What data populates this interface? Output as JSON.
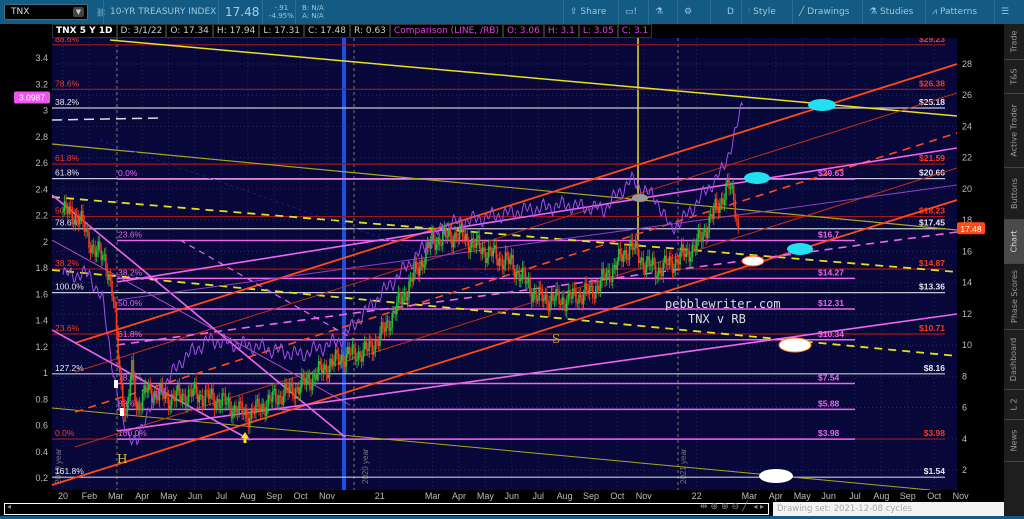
{
  "toolbar": {
    "symbol": "TNX",
    "description": "10-YR TREASURY INDEX",
    "last": "17.48",
    "change": "-.91",
    "change_pct": "-4.95%",
    "bid": "B: N/A",
    "ask": "A: N/A",
    "share": "Share",
    "timeframe": "D",
    "style": "Style",
    "drawings": "Drawings",
    "studies": "Studies",
    "patterns": "Patterns"
  },
  "header": {
    "title": "TNX 5 Y 1D",
    "date": "D: 3/1/22",
    "open": "O: 17.34",
    "high": "H: 17.94",
    "low": "L: 17.31",
    "close": "C: 17.48",
    "range": "R: 0.63",
    "comparison": "Comparison (LINE, /RB)",
    "cmp_open": "O: 3.06",
    "cmp_high": "H: 3.1",
    "cmp_low": "L: 3.05",
    "cmp_close": "C: 3.1"
  },
  "side_tabs": [
    "Trade",
    "T&S",
    "Active Trader",
    "Buttons",
    "Chart",
    "Phase Scores",
    "Dashboard",
    "L 2",
    "News"
  ],
  "footer": {
    "drawing_set": "Drawing set: 2021-12-08 cycles"
  },
  "chart_data": {
    "type": "candlestick",
    "title": "TNX 5 Y 1D vs /RB",
    "colors": {
      "up": "#22c23a",
      "down": "#ff3a1a",
      "comparison": "#a050e8",
      "white_fib": "#c8c8d8",
      "red_fib": "#ff3a1a",
      "pink_fib": "#ee66ee"
    },
    "x_ticks": [
      {
        "label": "20",
        "m": 0
      },
      {
        "label": "Feb",
        "m": 1
      },
      {
        "label": "Mar",
        "m": 2
      },
      {
        "label": "Apr",
        "m": 3
      },
      {
        "label": "May",
        "m": 4
      },
      {
        "label": "Jun",
        "m": 5
      },
      {
        "label": "Jul",
        "m": 6
      },
      {
        "label": "Aug",
        "m": 7
      },
      {
        "label": "Sep",
        "m": 8
      },
      {
        "label": "Oct",
        "m": 9
      },
      {
        "label": "Nov",
        "m": 10
      },
      {
        "label": "21",
        "m": 12
      },
      {
        "label": "Mar",
        "m": 14
      },
      {
        "label": "Apr",
        "m": 15
      },
      {
        "label": "May",
        "m": 16
      },
      {
        "label": "Jun",
        "m": 17
      },
      {
        "label": "Jul",
        "m": 18
      },
      {
        "label": "Aug",
        "m": 19
      },
      {
        "label": "Sep",
        "m": 20
      },
      {
        "label": "Oct",
        "m": 21
      },
      {
        "label": "Nov",
        "m": 22
      },
      {
        "label": "22",
        "m": 24
      },
      {
        "label": "Mar",
        "m": 26
      },
      {
        "label": "Apr",
        "m": 27
      },
      {
        "label": "May",
        "m": 28
      },
      {
        "label": "Jun",
        "m": 29
      },
      {
        "label": "Jul",
        "m": 30
      },
      {
        "label": "Aug",
        "m": 31
      },
      {
        "label": "Sep",
        "m": 32
      },
      {
        "label": "Oct",
        "m": 33
      },
      {
        "label": "Nov",
        "m": 34
      }
    ],
    "y_left_ticks": [
      "3.4",
      "3.2",
      "3",
      "2.8",
      "2.6",
      "2.4",
      "2.2",
      "2",
      "1.8",
      "1.6",
      "1.4",
      "1.2",
      "1",
      "0.8",
      "0.6",
      "0.4",
      "0.2"
    ],
    "y_right_ticks": [
      "28",
      "26",
      "24",
      "22",
      "20",
      "18",
      "16",
      "14",
      "12",
      "10",
      "8",
      "6",
      "4",
      "2"
    ],
    "left_badge": "3.0987",
    "right_badge": "17.48",
    "tnx_series": [
      [
        0,
        18.6
      ],
      [
        0.6,
        18.2
      ],
      [
        1.2,
        16.0
      ],
      [
        1.6,
        15.6
      ],
      [
        1.9,
        12.9
      ],
      [
        2.2,
        7.5
      ],
      [
        2.4,
        5.2
      ],
      [
        2.6,
        8.5
      ],
      [
        2.8,
        6.0
      ],
      [
        3.2,
        7.1
      ],
      [
        4,
        6.6
      ],
      [
        5,
        6.9
      ],
      [
        6,
        6.4
      ],
      [
        7,
        5.5
      ],
      [
        8,
        6.6
      ],
      [
        9,
        7.4
      ],
      [
        10,
        8.6
      ],
      [
        10.6,
        9.3
      ],
      [
        11.5,
        9.6
      ],
      [
        12,
        10.5
      ],
      [
        13,
        13.5
      ],
      [
        14,
        16.7
      ],
      [
        15,
        17.1
      ],
      [
        16,
        16.0
      ],
      [
        17,
        15.2
      ],
      [
        18,
        13.0
      ],
      [
        19,
        12.9
      ],
      [
        20,
        13.4
      ],
      [
        20.8,
        14.8
      ],
      [
        21.5,
        16.4
      ],
      [
        22,
        15.3
      ],
      [
        22.5,
        14.8
      ],
      [
        23.2,
        15.4
      ],
      [
        24,
        16.4
      ],
      [
        24.6,
        18.3
      ],
      [
        25.2,
        20.2
      ],
      [
        25.4,
        19.4
      ],
      [
        25.6,
        17.5
      ]
    ],
    "rb_series": [
      [
        0,
        1.75
      ],
      [
        1,
        1.75
      ],
      [
        1.5,
        1.55
      ],
      [
        2.2,
        0.64
      ],
      [
        2.8,
        0.45
      ],
      [
        3.2,
        0.72
      ],
      [
        4.5,
        1.1
      ],
      [
        5.5,
        1.25
      ],
      [
        7,
        1.21
      ],
      [
        9,
        1.14
      ],
      [
        10.5,
        1.25
      ],
      [
        12.5,
        1.7
      ],
      [
        14.5,
        2.13
      ],
      [
        17.5,
        2.24
      ],
      [
        19,
        2.28
      ],
      [
        20.5,
        2.25
      ],
      [
        21.5,
        2.47
      ],
      [
        22.5,
        2.32
      ],
      [
        23,
        2.1
      ],
      [
        23.5,
        2.17
      ],
      [
        25,
        2.55
      ],
      [
        25.5,
        2.85
      ],
      [
        25.8,
        3.1
      ]
    ],
    "fib_sets": [
      {
        "name": "white",
        "levels": [
          {
            "pct": "38.2%",
            "price": "$25.18",
            "value": 25.18
          },
          {
            "pct": "61.8%",
            "price": "$20.66",
            "value": 20.66
          },
          {
            "pct": "78.6%",
            "price": "$17.45",
            "value": 17.45
          },
          {
            "pct": "100.0%",
            "price": "$13.36",
            "value": 13.36
          },
          {
            "pct": "127.2%",
            "price": "$8.16",
            "value": 8.16
          },
          {
            "pct": "161.8%",
            "price": "$1.54",
            "value": 1.54
          }
        ]
      },
      {
        "name": "red",
        "levels": [
          {
            "pct": "88.6%",
            "price": "$29.23",
            "value": 29.23
          },
          {
            "pct": "78.6%",
            "price": "$26.38",
            "value": 26.38
          },
          {
            "pct": "61.8%",
            "price": "$21.59",
            "value": 21.59
          },
          {
            "pct": "50.0%",
            "price": "$18.23",
            "value": 18.23
          },
          {
            "pct": "38.2%",
            "price": "$14.87",
            "value": 14.87
          },
          {
            "pct": "23.6%",
            "price": "$10.71",
            "value": 10.71
          },
          {
            "pct": "0.0%",
            "price": "$3.98",
            "value": 3.98
          }
        ]
      },
      {
        "name": "pink",
        "levels": [
          {
            "pct": "0.0%",
            "price": "$20.63",
            "value": 20.63
          },
          {
            "pct": "23.6%",
            "price": "$16.7",
            "value": 16.7
          },
          {
            "pct": "38.2%",
            "price": "$14.27",
            "value": 14.27
          },
          {
            "pct": "50.0%",
            "price": "$12.31",
            "value": 12.31
          },
          {
            "pct": "61.8%",
            "price": "$10.34",
            "value": 10.34
          },
          {
            "pct": "78.6%",
            "price": "$7.54",
            "value": 7.54
          },
          {
            "pct": "88.6%",
            "price": "$5.88",
            "value": 5.88
          },
          {
            "pct": "100.0%",
            "price": "$3.98",
            "value": 3.98
          }
        ]
      }
    ],
    "annotations": {
      "watermark": "pebblewriter.com",
      "subtitle": "TNX v RB",
      "marker_h": "H",
      "marker_s": "S",
      "year_2019": "2019 year",
      "year_2020": "2020 year",
      "year_2021": "2021 year"
    }
  }
}
